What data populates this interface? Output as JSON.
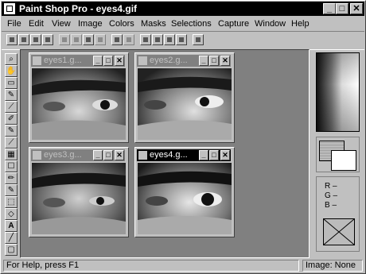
{
  "window": {
    "title": "Paint Shop Pro - eyes4.gif",
    "min": "_",
    "max": "□",
    "close": "✕"
  },
  "menu": [
    "File",
    "Edit",
    "View",
    "Image",
    "Colors",
    "Masks",
    "Selections",
    "Capture",
    "Window",
    "Help"
  ],
  "toolbar_icons": [
    "new-icon",
    "open-icon",
    "save-icon",
    "print-icon",
    "cut-icon",
    "copy-icon",
    "paste-icon",
    "undo-icon",
    "monitor-icon",
    "no-icon",
    "brush-icon",
    "window-icon",
    "columns-icon",
    "histogram-icon",
    "help-pointer-icon"
  ],
  "tools": [
    "zoom-icon",
    "hand-icon",
    "rect-select-icon",
    "lasso-icon",
    "eyedropper-icon",
    "paintbrush-icon",
    "clone-icon",
    "color-replace-icon",
    "retouch-icon",
    "scratch-icon",
    "eraser-icon",
    "airbrush-icon",
    "fill-icon",
    "flood-fill-icon",
    "text-icon",
    "line-icon",
    "shape-icon"
  ],
  "tool_glyphs": [
    "⌕",
    "✋",
    "▭",
    "✎",
    "⟋",
    "✐",
    "✎",
    "⟋",
    "▦",
    "☐",
    "✏",
    "✎",
    "⬚",
    "◇",
    "A",
    "╱",
    "▢"
  ],
  "documents": [
    {
      "title": "eyes1.g...",
      "active": false
    },
    {
      "title": "eyes2.g...",
      "active": false
    },
    {
      "title": "eyes3.g...",
      "active": false
    },
    {
      "title": "eyes4.g...",
      "active": true
    }
  ],
  "doc_buttons": {
    "min": "_",
    "max": "□",
    "close": "✕"
  },
  "color_panel": {
    "r_label": "R –",
    "g_label": "G –",
    "b_label": "B –"
  },
  "status": {
    "help": "For Help, press F1",
    "image": "Image: None"
  }
}
